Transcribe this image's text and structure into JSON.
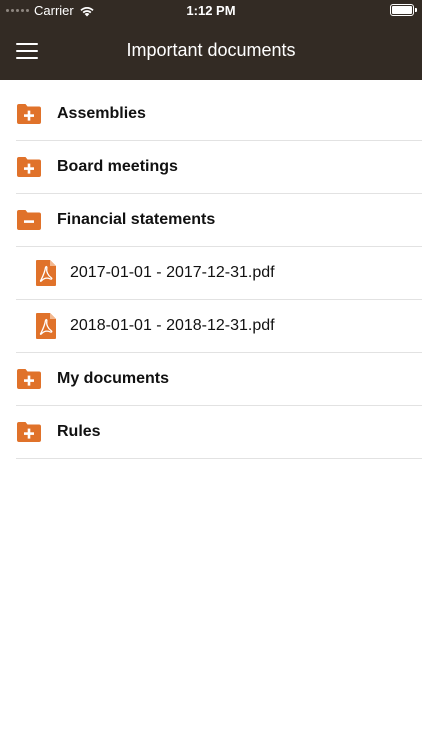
{
  "status_bar": {
    "carrier": "Carrier",
    "time": "1:12 PM"
  },
  "nav": {
    "title": "Important documents",
    "menu_icon": "hamburger-menu-icon"
  },
  "theme": {
    "bar_color": "#332b24",
    "accent_color": "#e0722a"
  },
  "items": [
    {
      "type": "folder",
      "state": "collapsed",
      "icon": "folder-plus-icon",
      "label": "Assemblies"
    },
    {
      "type": "folder",
      "state": "collapsed",
      "icon": "folder-plus-icon",
      "label": "Board meetings"
    },
    {
      "type": "folder",
      "state": "expanded",
      "icon": "folder-minus-icon",
      "label": "Financial statements"
    },
    {
      "type": "file",
      "icon": "pdf-file-icon",
      "label": "2017-01-01 - 2017-12-31.pdf"
    },
    {
      "type": "file",
      "icon": "pdf-file-icon",
      "label": "2018-01-01 - 2018-12-31.pdf"
    },
    {
      "type": "folder",
      "state": "collapsed",
      "icon": "folder-plus-icon",
      "label": "My documents"
    },
    {
      "type": "folder",
      "state": "collapsed",
      "icon": "folder-plus-icon",
      "label": "Rules"
    }
  ]
}
